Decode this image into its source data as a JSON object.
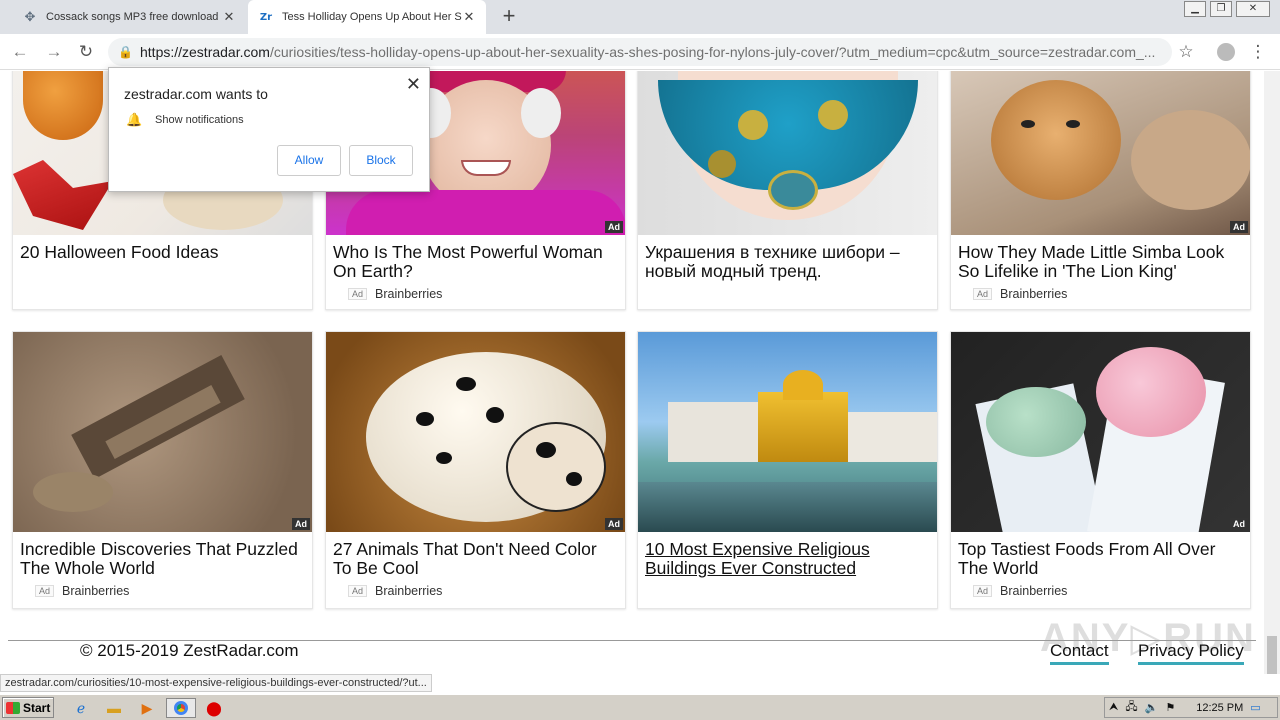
{
  "browser": {
    "tabs": [
      {
        "title": "Cossack songs MP3 free download a",
        "active": false
      },
      {
        "title": "Tess Holliday Opens Up About Her S",
        "active": true
      }
    ],
    "url_host": "https://zestradar.com",
    "url_path": "/curiosities/tess-holliday-opens-up-about-her-sexuality-as-shes-posing-for-nylons-july-cover/?utm_medium=cpc&utm_source=zestradar.com_..."
  },
  "permission_popup": {
    "title": "zestradar.com wants to",
    "row": "Show notifications",
    "allow": "Allow",
    "block": "Block"
  },
  "row1": [
    {
      "caption": "20 Halloween Food Ideas",
      "source": "",
      "ad": false
    },
    {
      "caption": "Who Is The Most Powerful Woman On Earth?",
      "source": "Brainberries",
      "ad": true
    },
    {
      "caption": "Украшения в технике шибори – новый модный тренд.",
      "source": "",
      "ad": false
    },
    {
      "caption": "How They Made Little Simba Look So Lifelike in 'The Lion King'",
      "source": "Brainberries",
      "ad": true
    }
  ],
  "row2": [
    {
      "caption": "Incredible Discoveries That Puzzled The Whole World",
      "source": "Brainberries",
      "ad": true
    },
    {
      "caption": "27 Animals That Don't Need Color To Be Cool",
      "source": "Brainberries",
      "ad": true
    },
    {
      "caption": "10 Most Expensive Religious Buildings Ever Constructed",
      "source": "",
      "ad": false
    },
    {
      "caption": "Top Tastiest Foods From All Over The World",
      "source": "Brainberries",
      "ad": true
    }
  ],
  "ad_label": "Ad",
  "footer": {
    "copyright": "© 2015-2019 ZestRadar.com",
    "contact": "Contact",
    "privacy": "Privacy Policy"
  },
  "status_url": "zestradar.com/curiosities/10-most-expensive-religious-buildings-ever-constructed/?ut...",
  "taskbar": {
    "start": "Start",
    "time": "12:25 PM"
  },
  "colors": {
    "accent": "#3aa8b8",
    "link": "#1a73e8"
  }
}
